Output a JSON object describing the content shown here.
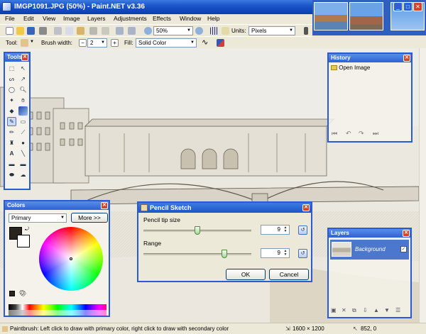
{
  "window": {
    "title": "IMGP1091.JPG (50%) - Paint.NET v3.36"
  },
  "menu": [
    "File",
    "Edit",
    "View",
    "Image",
    "Layers",
    "Adjustments",
    "Effects",
    "Window",
    "Help"
  ],
  "toolbar": {
    "zoom_value": "50%",
    "units_label": "Units:",
    "units_value": "Pixels"
  },
  "tool_options": {
    "tool_label": "Tool:",
    "brush_width_label": "Brush width:",
    "brush_width_value": "2",
    "fill_label": "Fill:",
    "fill_value": "Solid Color"
  },
  "tools_panel": {
    "title": "Tools"
  },
  "history_panel": {
    "title": "History",
    "items": [
      "Open Image"
    ]
  },
  "colors_panel": {
    "title": "Colors",
    "mode_value": "Primary",
    "more_button": "More >>"
  },
  "layers_panel": {
    "title": "Layers",
    "layer_name": "Background"
  },
  "dialog": {
    "title": "Pencil Sketch",
    "tip_size_label": "Pencil tip size",
    "tip_size_value": "9",
    "tip_size_fraction": 0.5,
    "range_label": "Range",
    "range_value": "9",
    "range_fraction": 0.75,
    "ok_label": "OK",
    "cancel_label": "Cancel"
  },
  "status": {
    "hint": "Paintbrush: Left click to draw with primary color, right click to draw with secondary color",
    "image_size": "1600 × 1200",
    "cursor_pos": "852, 0"
  },
  "colors": {
    "title_blue": "#1b55c9",
    "panel_border": "#2a5bd0",
    "chrome": "#ece9d8",
    "primary_color": "#2a241e",
    "secondary_color": "#ffffff"
  }
}
